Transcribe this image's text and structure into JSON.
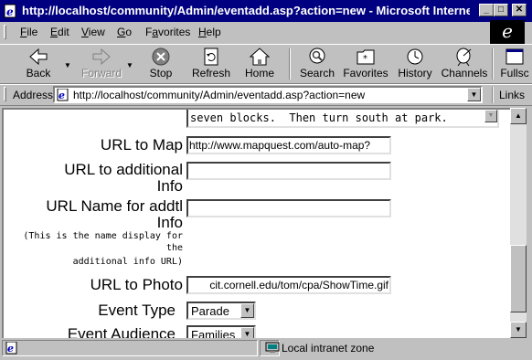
{
  "window": {
    "title": "http://localhost/community/Admin/eventadd.asp?action=new - Microsoft Internet Exp...",
    "minimize": "_",
    "maximize": "□",
    "close": "✕"
  },
  "menu": {
    "items": [
      {
        "key": "F",
        "rest": "ile"
      },
      {
        "key": "E",
        "rest": "dit"
      },
      {
        "key": "V",
        "rest": "iew"
      },
      {
        "key": "G",
        "rest": "o"
      },
      {
        "key": "",
        "pre": "F",
        "rest": "avorites",
        "accel": "a"
      },
      {
        "key": "H",
        "rest": "elp"
      }
    ]
  },
  "toolbar": {
    "back": "Back",
    "forward": "Forward",
    "stop": "Stop",
    "refresh": "Refresh",
    "home": "Home",
    "search": "Search",
    "favorites": "Favorites",
    "history": "History",
    "channels": "Channels",
    "fullscreen": "Fullsc"
  },
  "address": {
    "label": "Address",
    "url": "http://localhost/community/Admin/eventadd.asp?action=new",
    "links": "Links"
  },
  "form": {
    "textarea_tail": "seven blocks.  Then turn south at park.",
    "url_map_label": "URL to Map",
    "url_map_value": "http://www.mapquest.com/auto-map?",
    "url_info_label_1": "URL to additional",
    "url_info_label_2": "Info",
    "url_info_value": "",
    "url_name_label_1": "URL Name for addtl",
    "url_name_label_2": "Info",
    "url_name_note_1": "(This is the name display for",
    "url_name_note_2": "the",
    "url_name_note_3": "additional info URL)",
    "url_name_value": "",
    "url_photo_label": "URL to Photo",
    "url_photo_value": "cit.cornell.edu/tom/cpa/ShowTime.gif",
    "event_type_label": "Event Type",
    "event_type_value": "Parade",
    "event_audience_label": "Event Audience",
    "event_audience_value": "Families"
  },
  "status": {
    "zone": "Local intranet zone"
  }
}
